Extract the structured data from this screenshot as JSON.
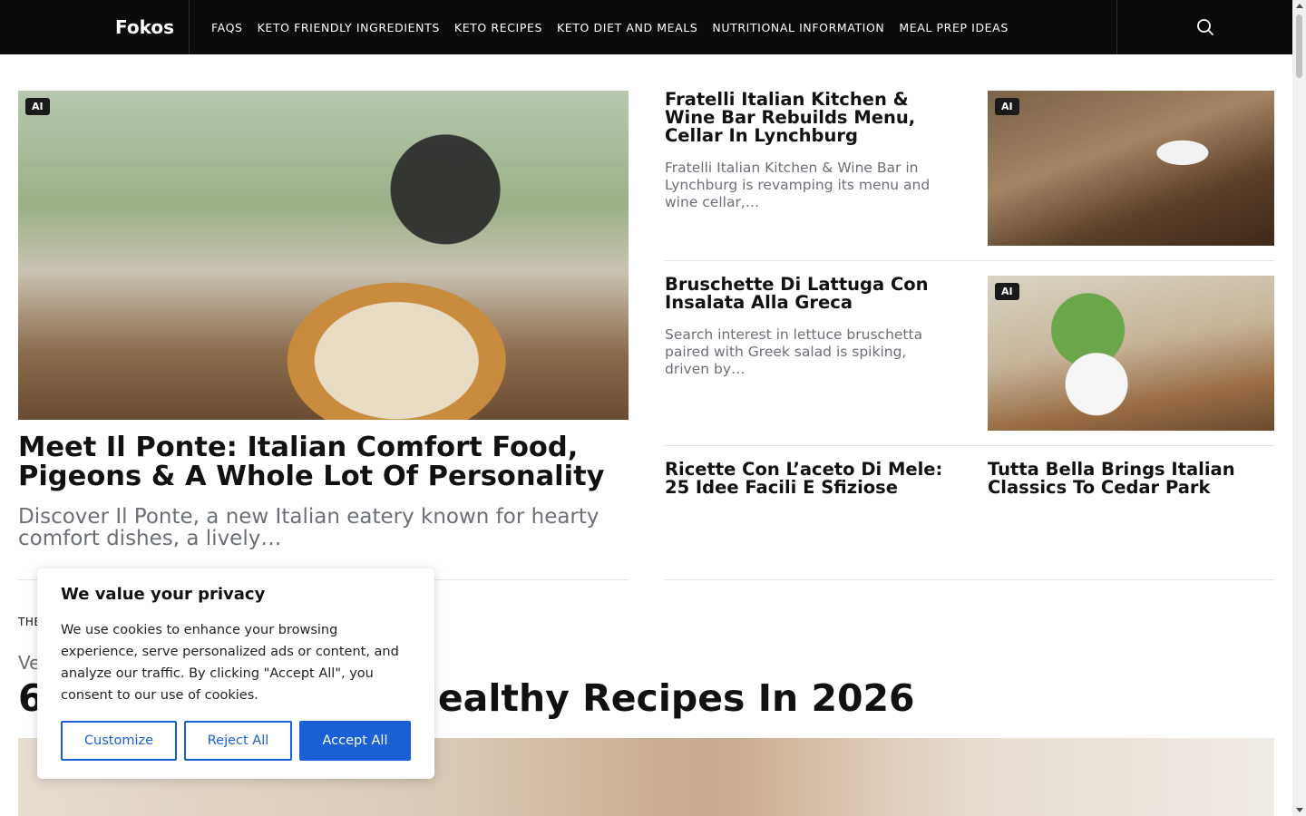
{
  "header": {
    "brand": "Fokos",
    "nav": [
      "FAQS",
      "KETO FRIENDLY INGREDIENTS",
      "KETO RECIPES",
      "KETO DIET AND MEALS",
      "NUTRITIONAL INFORMATION",
      "MEAL PREP IDEAS"
    ],
    "search_icon": "search-icon"
  },
  "hero": {
    "badge": "AI",
    "title": "Meet Il Ponte: Italian Comfort Food, Pigeons & A Whole Lot Of Personality",
    "excerpt": "Discover Il Ponte, a new Italian eatery known for hearty comfort dishes, a lively…"
  },
  "side_articles": [
    {
      "title": "Fratelli Italian Kitchen & Wine Bar Rebuilds Menu, Cellar In Lynchburg",
      "excerpt": "Fratelli Italian Kitchen & Wine Bar in Lynchburg is revamping its menu and wine cellar,…",
      "badge": "AI"
    },
    {
      "title": "Bruschette Di Lattuga Con Insalata Alla Greca",
      "excerpt": "Search interest in lettuce bruschetta paired with Greek salad is spiking, driven by…",
      "badge": "AI"
    },
    {
      "title": "Ricette Con L’aceto Di Mele: 25 Idee Facili E Sfiziose"
    },
    {
      "title": "Tutta Bella Brings Italian Classics To Cedar Park"
    }
  ],
  "section": {
    "kicker": "THE",
    "category": "Ve",
    "title_left": "6",
    "title_right": "Healthy Recipes In 2026"
  },
  "cookie": {
    "title": "We value your privacy",
    "body": "We use cookies to enhance your browsing experience, serve personalized ads or content, and analyze our traffic. By clicking \"Accept All\", you consent to our use of cookies.",
    "customize": "Customize",
    "reject": "Reject All",
    "accept": "Accept All"
  },
  "colors": {
    "header_bg": "#0b0b0b",
    "accent": "#1a5fd6",
    "muted_text": "#6b6f76"
  }
}
